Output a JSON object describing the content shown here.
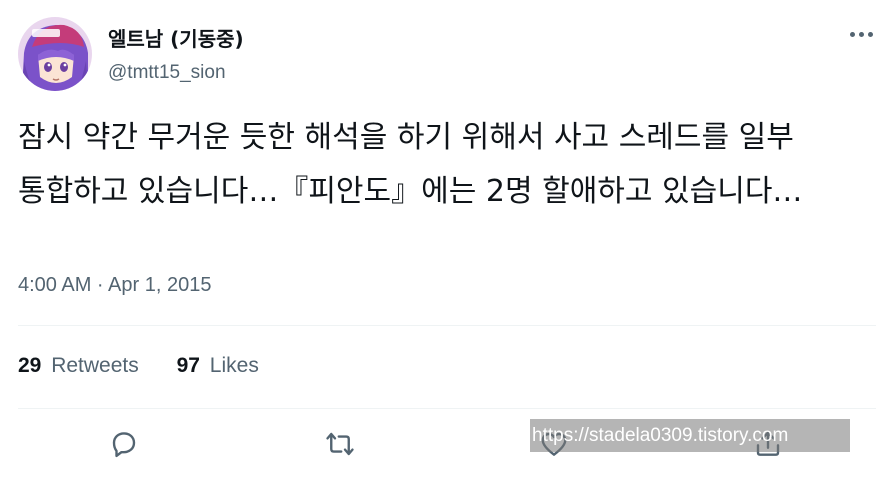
{
  "user": {
    "display_name": "엘트남 (기동중)",
    "handle": "@tmtt15_sion",
    "avatar_icon": "anime-avatar"
  },
  "tweet": {
    "text": "잠시 약간 무거운 듯한 해석을 하기 위해서 사고 스레드를 일부 통합하고 있습니다…『피안도』에는 2명 할애하고 있습니다…",
    "timestamp": "4:00 AM · Apr 1, 2015"
  },
  "stats": {
    "retweets_count": "29",
    "retweets_label": "Retweets",
    "likes_count": "97",
    "likes_label": "Likes"
  },
  "actions": [
    "reply-icon",
    "retweet-icon",
    "like-icon",
    "share-icon"
  ],
  "watermark": "https://stadela0309.tistory.com",
  "colors": {
    "text_primary": "#0f1419",
    "text_secondary": "#536471",
    "divider": "#eff3f4",
    "avatar_hair": "#7b52c9",
    "avatar_cap": "#c43c7a"
  }
}
